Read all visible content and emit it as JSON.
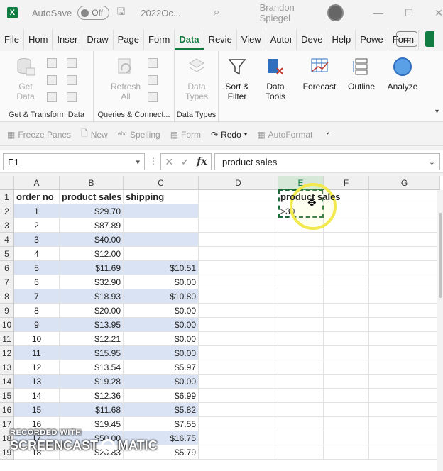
{
  "titlebar": {
    "logo": "X",
    "autosave_label": "AutoSave",
    "autosave_state": "Off",
    "file_name": "2022Oc...",
    "user_name": "Brandon Spiegel"
  },
  "menu": [
    "File",
    "Hom",
    "Inser",
    "Draw",
    "Page",
    "Form",
    "Data",
    "Revie",
    "View",
    "Autoı",
    "Deve",
    "Help",
    "Powe",
    "Form"
  ],
  "menu_active": "Data",
  "ribbon": {
    "get_data": "Get Data",
    "refresh_all": "Refresh All",
    "data_types": "Data Types",
    "sort_filter": "Sort & Filter",
    "data_tools": "Data Tools",
    "forecast": "Forecast",
    "outline": "Outline",
    "analyze": "Analyze",
    "group_get": "Get & Transform Data",
    "group_queries": "Queries & Connect...",
    "group_types": "Data Types"
  },
  "quickaccess": {
    "freeze": "Freeze Panes",
    "new": "New",
    "spelling": "Spelling",
    "form": "Form",
    "redo": "Redo",
    "autoformat": "AutoFormat"
  },
  "formula_bar": {
    "name_box": "E1",
    "formula": "product sales",
    "fx": "fx"
  },
  "columns": [
    "A",
    "B",
    "C",
    "D",
    "E",
    "F",
    "G"
  ],
  "rows": [
    "1",
    "2",
    "3",
    "4",
    "5",
    "6",
    "7",
    "8",
    "9",
    "10",
    "11",
    "12",
    "13",
    "14",
    "15",
    "16",
    "17",
    "18",
    "19"
  ],
  "headers": {
    "a": "order no",
    "b": "product sales",
    "c": "shipping"
  },
  "data": [
    {
      "a": "1",
      "b": "$29.70",
      "c": ""
    },
    {
      "a": "2",
      "b": "$87.89",
      "c": ""
    },
    {
      "a": "3",
      "b": "$40.00",
      "c": ""
    },
    {
      "a": "4",
      "b": "$12.00",
      "c": ""
    },
    {
      "a": "5",
      "b": "$11.69",
      "c": "$10.51"
    },
    {
      "a": "6",
      "b": "$32.90",
      "c": "$0.00"
    },
    {
      "a": "7",
      "b": "$18.93",
      "c": "$10.80"
    },
    {
      "a": "8",
      "b": "$20.00",
      "c": "$0.00"
    },
    {
      "a": "9",
      "b": "$13.95",
      "c": "$0.00"
    },
    {
      "a": "10",
      "b": "$12.21",
      "c": "$0.00"
    },
    {
      "a": "11",
      "b": "$15.95",
      "c": "$0.00"
    },
    {
      "a": "12",
      "b": "$13.54",
      "c": "$5.97"
    },
    {
      "a": "13",
      "b": "$19.28",
      "c": "$0.00"
    },
    {
      "a": "14",
      "b": "$12.36",
      "c": "$6.99"
    },
    {
      "a": "15",
      "b": "$11.68",
      "c": "$5.82"
    },
    {
      "a": "16",
      "b": "$19.45",
      "c": "$7.55"
    },
    {
      "a": "17",
      "b": "$50.00",
      "c": "$16.75"
    },
    {
      "a": "18",
      "b": "$20.83",
      "c": "$5.79"
    },
    {
      "a": "19",
      "b": "$23.76",
      "c": "$0.00"
    }
  ],
  "criteria": {
    "e1": "product sales",
    "e2": ">30"
  },
  "watermark": {
    "line1": "RECORDED WITH",
    "line2a": "SCREENCAST",
    "line2b": "MATIC"
  },
  "colors": {
    "accent": "#107c41",
    "band": "#dae3f3"
  }
}
